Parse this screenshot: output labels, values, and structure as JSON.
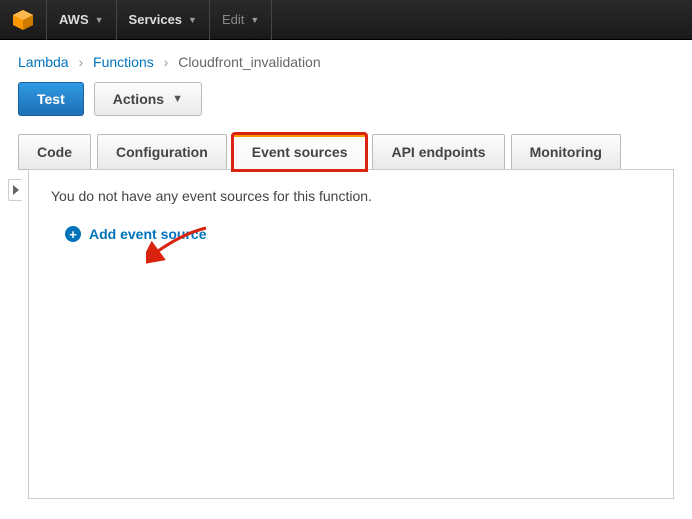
{
  "header": {
    "brand": "AWS",
    "services": "Services",
    "edit": "Edit"
  },
  "breadcrumb": {
    "lambda": "Lambda",
    "functions": "Functions",
    "current": "Cloudfront_invalidation"
  },
  "buttons": {
    "test": "Test",
    "actions": "Actions"
  },
  "tabs": {
    "code": "Code",
    "configuration": "Configuration",
    "event_sources": "Event sources",
    "api_endpoints": "API endpoints",
    "monitoring": "Monitoring"
  },
  "content": {
    "empty": "You do not have any event sources for this function.",
    "add": "Add event source"
  }
}
